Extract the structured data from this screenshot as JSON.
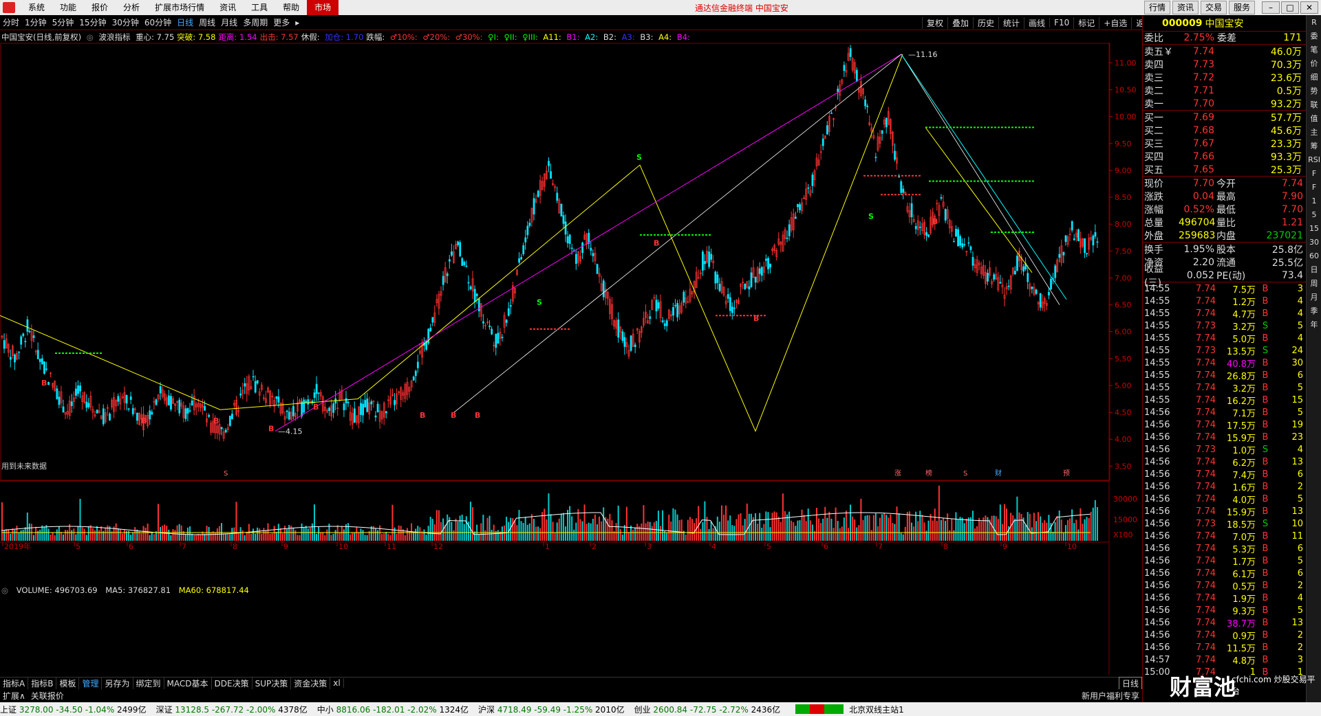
{
  "menu": {
    "items": [
      "系统",
      "功能",
      "报价",
      "分析",
      "扩展市场行情",
      "资讯",
      "工具",
      "帮助"
    ],
    "active": "市场",
    "center_title": "通达信金融终端  中国宝安",
    "right_buttons": [
      "行情",
      "资讯",
      "交易",
      "服务"
    ]
  },
  "periods": [
    "分时",
    "1分钟",
    "5分钟",
    "15分钟",
    "30分钟",
    "60分钟",
    "日线",
    "周线",
    "月线",
    "多周期",
    "更多"
  ],
  "active_period": "日线",
  "tools": [
    "复权",
    "叠加",
    "历史",
    "统计",
    "画线",
    "F10",
    "标记",
    "+自选",
    "返回"
  ],
  "indicator_line": {
    "stock": "中国宝安(日线,前复权)",
    "indicator": "波浪指标",
    "items": [
      {
        "t": "重心: 7.75",
        "c": "#ddd"
      },
      {
        "t": "突破: 7.58",
        "c": "#ff0"
      },
      {
        "t": "距离: 1.54",
        "c": "#f0f"
      },
      {
        "t": "出击: 7.57",
        "c": "#f33"
      },
      {
        "t": "休假: ",
        "c": "#ddd"
      },
      {
        "t": "加仓: 1.70",
        "c": "#33f"
      },
      {
        "t": "跌幅: ",
        "c": "#ddd"
      },
      {
        "t": "♂10%: ",
        "c": "#f33"
      },
      {
        "t": "♂20%: ",
        "c": "#f33"
      },
      {
        "t": "♂30%: ",
        "c": "#f33"
      },
      {
        "t": "♀I: ",
        "c": "#0f0"
      },
      {
        "t": "♀II: ",
        "c": "#0f0"
      },
      {
        "t": "♀III: ",
        "c": "#0f0"
      },
      {
        "t": "A11: ",
        "c": "#ff0"
      },
      {
        "t": "B1: ",
        "c": "#f0f"
      },
      {
        "t": "A2: ",
        "c": "#0ff"
      },
      {
        "t": "B2: ",
        "c": "#ddd"
      },
      {
        "t": "A3: ",
        "c": "#33f"
      },
      {
        "t": "B3: ",
        "c": "#ddd"
      },
      {
        "t": "A4: ",
        "c": "#ff0"
      },
      {
        "t": "B4: ",
        "c": "#f0f"
      }
    ]
  },
  "chart_data": {
    "type": "candlestick",
    "title": "中国宝安(日线,前复权)",
    "y_ticks": [
      "11.00",
      "10.50",
      "10.00",
      "9.50",
      "9.00",
      "8.50",
      "8.00",
      "7.50",
      "7.00",
      "6.50",
      "6.00",
      "5.50",
      "5.00",
      "4.50",
      "4.00",
      "3.50"
    ],
    "ylim": [
      3.3,
      11.3
    ],
    "high_label": "11.16",
    "low_label": "4.15",
    "month_labels": [
      "2019年",
      "5",
      "6",
      "7",
      "8",
      "9",
      "10",
      "11",
      "12",
      "1",
      "2",
      "3",
      "4",
      "5",
      "6",
      "7",
      "8",
      "9",
      "10"
    ],
    "note_future": "用到未来数据",
    "event_tags": [
      "S",
      "涨",
      "榜",
      "S",
      "财",
      "预"
    ],
    "volume": {
      "label": "VOLUME: 496703.69",
      "ma5": "MA5: 376827.81",
      "ma60": "MA60: 678817.44",
      "ticks": [
        "30000",
        "15000",
        "X100"
      ]
    },
    "price_path": [
      5.9,
      5.5,
      6.1,
      5.4,
      5.0,
      4.5,
      4.9,
      4.6,
      4.4,
      4.8,
      4.6,
      4.3,
      4.9,
      4.7,
      4.5,
      4.8,
      4.2,
      4.15,
      4.6,
      5.1,
      4.9,
      4.7,
      4.4,
      4.6,
      4.9,
      4.5,
      4.8,
      4.4,
      4.6,
      4.5,
      4.7,
      4.9,
      5.5,
      6.1,
      7.1,
      7.6,
      6.9,
      6.2,
      5.8,
      6.5,
      7.6,
      8.5,
      9.1,
      8.1,
      7.3,
      7.8,
      6.9,
      6.2,
      5.7,
      6.0,
      6.6,
      6.2,
      6.5,
      6.8,
      7.5,
      6.9,
      6.4,
      6.9,
      7.1,
      7.4,
      7.7,
      8.2,
      8.7,
      9.5,
      10.3,
      11.16,
      10.4,
      9.4,
      10.0,
      8.6,
      8.1,
      7.9,
      8.4,
      7.8,
      7.6,
      7.1,
      7.0,
      6.7,
      7.4,
      6.8,
      6.5,
      7.3,
      7.9,
      7.6,
      7.7
    ]
  },
  "bottom_tabs": [
    "指标A",
    "指标B",
    "模板",
    "管理",
    "另存为",
    "绑定到",
    "MACD基本",
    "DDE决策",
    "SUP决策",
    "资金决策",
    "xl"
  ],
  "bottom_active": "管理",
  "sub_tabs": [
    "扩展∧",
    "关联报价"
  ],
  "right_small": [
    "日线"
  ],
  "status": {
    "indices": [
      {
        "name": "上证",
        "val": "3278.00",
        "chg": "-34.50",
        "pct": "-1.04%",
        "amt": "2499亿"
      },
      {
        "name": "深证",
        "val": "13128.5",
        "chg": "-267.72",
        "pct": "-2.00%",
        "amt": "4378亿"
      },
      {
        "name": "中小",
        "val": "8816.06",
        "chg": "-182.01",
        "pct": "-2.02%",
        "amt": "1324亿"
      },
      {
        "name": "沪深",
        "val": "4718.49",
        "chg": "-59.49",
        "pct": "-1.25%",
        "amt": "2010亿"
      },
      {
        "name": "创业",
        "val": "2600.84",
        "chg": "-72.75",
        "pct": "-2.72%",
        "amt": "2436亿"
      }
    ],
    "server": "北京双线主站1",
    "promo": "新用户福利专享"
  },
  "quote": {
    "code": "000009",
    "name": "中国宝安",
    "weibi_l": "委比",
    "weibi": "2.75%",
    "weicha_l": "委差",
    "weicha": "171",
    "asks": [
      {
        "l": "卖五￥",
        "p": "7.74",
        "v": "46.0万"
      },
      {
        "l": "卖四",
        "p": "7.73",
        "v": "70.3万"
      },
      {
        "l": "卖三",
        "p": "7.72",
        "v": "23.6万"
      },
      {
        "l": "卖二",
        "p": "7.71",
        "v": "0.5万"
      },
      {
        "l": "卖一",
        "p": "7.70",
        "v": "93.2万"
      }
    ],
    "bids": [
      {
        "l": "买一",
        "p": "7.69",
        "v": "57.7万"
      },
      {
        "l": "买二",
        "p": "7.68",
        "v": "45.6万"
      },
      {
        "l": "买三",
        "p": "7.67",
        "v": "23.3万"
      },
      {
        "l": "买四",
        "p": "7.66",
        "v": "93.3万"
      },
      {
        "l": "买五",
        "p": "7.65",
        "v": "25.3万"
      }
    ],
    "stats": [
      [
        "现价",
        "7.70",
        "今开",
        "7.74"
      ],
      [
        "涨跌",
        "0.04",
        "最高",
        "7.90"
      ],
      [
        "涨幅",
        "0.52%",
        "最低",
        "7.70"
      ],
      [
        "总量",
        "496704",
        "量比",
        "1.21"
      ],
      [
        "外盘",
        "259683",
        "内盘",
        "237021"
      ]
    ],
    "stats2": [
      [
        "换手",
        "1.95%",
        "股本",
        "25.8亿"
      ],
      [
        "净资",
        "2.20",
        "流通",
        "25.5亿"
      ],
      [
        "收益(三)",
        "0.052",
        "PE(动)",
        "73.4"
      ]
    ]
  },
  "ticks": [
    [
      "14:55",
      "7.74",
      "7.5万",
      "B",
      "3"
    ],
    [
      "14:55",
      "7.74",
      "1.2万",
      "B",
      "4"
    ],
    [
      "14:55",
      "7.74",
      "4.7万",
      "B",
      "4"
    ],
    [
      "14:55",
      "7.73",
      "3.2万",
      "S",
      "5"
    ],
    [
      "14:55",
      "7.74",
      "5.0万",
      "B",
      "4"
    ],
    [
      "14:55",
      "7.73",
      "13.5万",
      "S",
      "24"
    ],
    [
      "14:55",
      "7.74",
      "40.8万",
      "B",
      "30"
    ],
    [
      "14:55",
      "7.74",
      "26.8万",
      "B",
      "6"
    ],
    [
      "14:55",
      "7.74",
      "3.2万",
      "B",
      "5"
    ],
    [
      "14:55",
      "7.74",
      "16.2万",
      "B",
      "15"
    ],
    [
      "14:56",
      "7.74",
      "7.1万",
      "B",
      "5"
    ],
    [
      "14:56",
      "7.74",
      "17.5万",
      "B",
      "19"
    ],
    [
      "14:56",
      "7.74",
      "15.9万",
      "B",
      "23"
    ],
    [
      "14:56",
      "7.73",
      "1.0万",
      "S",
      "4"
    ],
    [
      "14:56",
      "7.74",
      "6.2万",
      "B",
      "13"
    ],
    [
      "14:56",
      "7.74",
      "7.4万",
      "B",
      "6"
    ],
    [
      "14:56",
      "7.74",
      "1.6万",
      "B",
      "2"
    ],
    [
      "14:56",
      "7.74",
      "4.0万",
      "B",
      "5"
    ],
    [
      "14:56",
      "7.74",
      "15.9万",
      "B",
      "13"
    ],
    [
      "14:56",
      "7.73",
      "18.5万",
      "S",
      "10"
    ],
    [
      "14:56",
      "7.74",
      "7.0万",
      "B",
      "11"
    ],
    [
      "14:56",
      "7.74",
      "5.3万",
      "B",
      "6"
    ],
    [
      "14:56",
      "7.74",
      "1.7万",
      "B",
      "5"
    ],
    [
      "14:56",
      "7.74",
      "6.1万",
      "B",
      "6"
    ],
    [
      "14:56",
      "7.74",
      "0.5万",
      "B",
      "2"
    ],
    [
      "14:56",
      "7.74",
      "1.9万",
      "B",
      "4"
    ],
    [
      "14:56",
      "7.74",
      "9.3万",
      "B",
      "5"
    ],
    [
      "14:56",
      "7.74",
      "38.7万",
      "B",
      "13"
    ],
    [
      "14:56",
      "7.74",
      "0.9万",
      "B",
      "2"
    ],
    [
      "14:56",
      "7.74",
      "11.5万",
      "B",
      "2"
    ],
    [
      "14:57",
      "7.74",
      "4.8万",
      "B",
      "3"
    ],
    [
      "15:00",
      "7.74",
      "1",
      "B",
      "1"
    ]
  ],
  "sidebar": [
    "R",
    "委",
    "笔",
    "价",
    "细",
    "势",
    "联",
    "值",
    "主",
    "筹",
    "RSI",
    "F",
    "F",
    "1",
    "5",
    "15",
    "30",
    "60",
    "日",
    "周",
    "月",
    "季",
    "年"
  ],
  "watermark": "财富池",
  "watermark_sub": "cfchi.com 炒股交易平台"
}
